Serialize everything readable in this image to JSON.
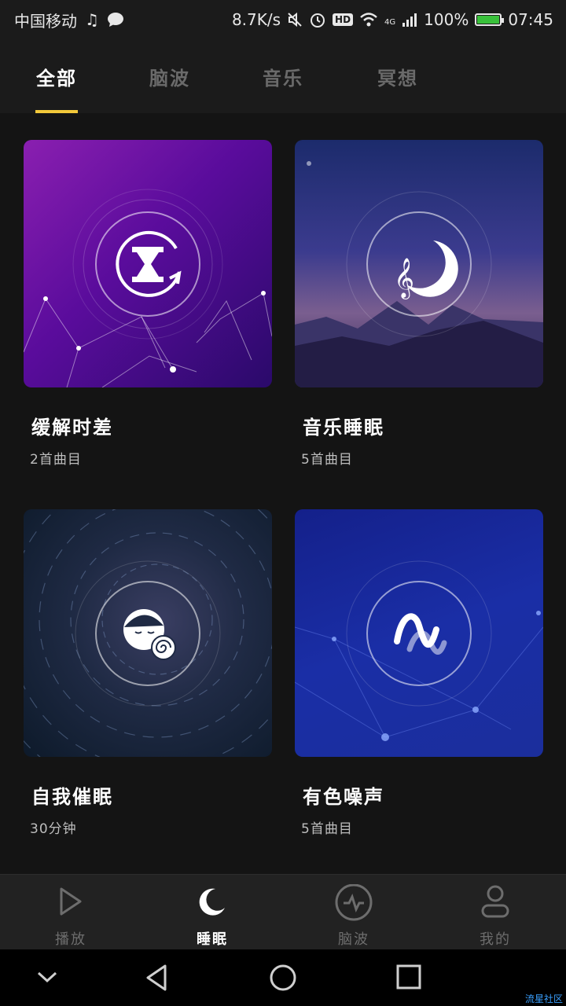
{
  "statusbar": {
    "carrier": "中国移动",
    "net_speed": "8.7K/s",
    "hd": "HD",
    "net_type": "4G",
    "battery": "100%",
    "time": "07:45"
  },
  "tabs": [
    {
      "label": "全部",
      "active": true
    },
    {
      "label": "脑波",
      "active": false
    },
    {
      "label": "音乐",
      "active": false
    },
    {
      "label": "冥想",
      "active": false
    }
  ],
  "cards": [
    {
      "title": "缓解时差",
      "subtitle": "2首曲目",
      "icon": "hourglass-rotate-icon"
    },
    {
      "title": "音乐睡眠",
      "subtitle": "5首曲目",
      "icon": "moon-music-icon"
    },
    {
      "title": "自我催眠",
      "subtitle": "30分钟",
      "icon": "face-spiral-icon"
    },
    {
      "title": "有色噪声",
      "subtitle": "5首曲目",
      "icon": "wave-icon"
    }
  ],
  "bottomnav": [
    {
      "label": "播放",
      "icon": "play-icon",
      "active": false
    },
    {
      "label": "睡眠",
      "icon": "moon-icon",
      "active": true
    },
    {
      "label": "脑波",
      "icon": "pulse-icon",
      "active": false
    },
    {
      "label": "我的",
      "icon": "user-icon",
      "active": false
    }
  ],
  "watermark": "流星社区",
  "colors": {
    "accent": "#f3c93b",
    "background": "#141414"
  }
}
